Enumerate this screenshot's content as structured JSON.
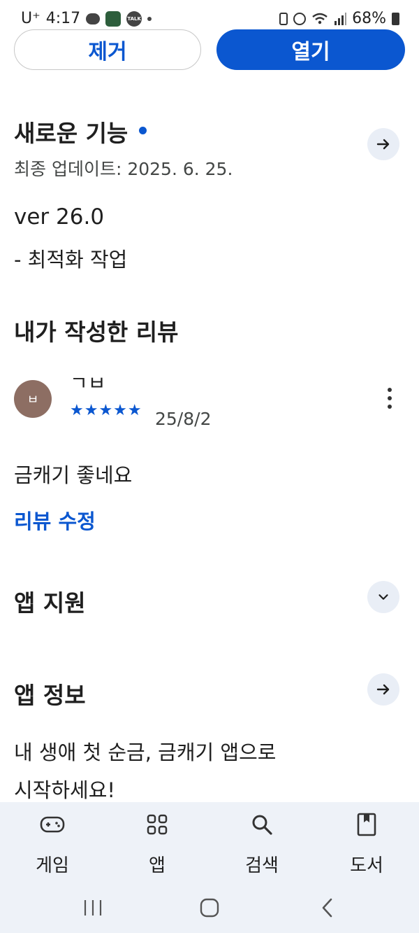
{
  "status_bar": {
    "carrier": "U⁺",
    "time": "4:17",
    "battery": "68%",
    "talk_label": "TALK"
  },
  "actions": {
    "remove_label": "제거",
    "open_label": "열기"
  },
  "whats_new": {
    "title": "새로운 기능",
    "last_updated": "최종 업데이트: 2025. 6. 25.",
    "version": "ver 26.0",
    "notes": "- 최적화 작업"
  },
  "my_review": {
    "title": "내가 작성한 리뷰",
    "reviewer_name": "ㄱㅂ",
    "avatar_initial": "ㅂ",
    "rating_stars": 5,
    "stars_text": "★★★★★",
    "date": "25/8/2",
    "text": "금캐기 좋네요",
    "edit_label": "리뷰 수정"
  },
  "app_support": {
    "title": "앱 지원"
  },
  "app_info": {
    "title": "앱 정보",
    "description_line1": "내 생애 첫 순금, 금캐기 앱으로",
    "description_line2": "시작하세요!"
  },
  "bottom_nav": {
    "items": [
      {
        "label": "게임",
        "icon": "gamepad-icon"
      },
      {
        "label": "앱",
        "icon": "apps-grid-icon"
      },
      {
        "label": "검색",
        "icon": "search-icon"
      },
      {
        "label": "도서",
        "icon": "book-icon"
      }
    ]
  },
  "colors": {
    "accent": "#0b57d0",
    "nav_background": "#eef2f8",
    "avatar": "#8d6e63"
  }
}
